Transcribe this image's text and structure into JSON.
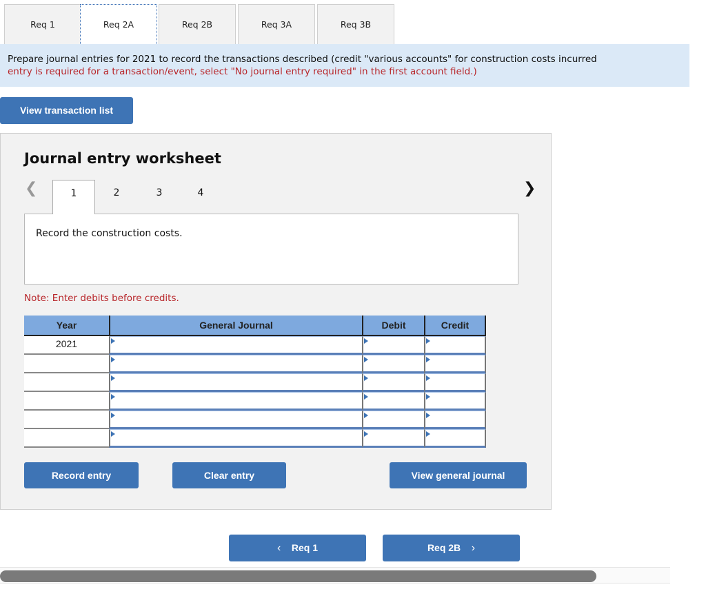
{
  "req_tabs": [
    {
      "label": "Req 1",
      "active": false
    },
    {
      "label": "Req 2A",
      "active": true
    },
    {
      "label": "Req 2B",
      "active": false
    },
    {
      "label": "Req 3A",
      "active": false
    },
    {
      "label": "Req 3B",
      "active": false
    }
  ],
  "instructions": {
    "line1": "Prepare journal entries for 2021 to record the transactions described (credit \"various accounts\" for construction costs incurred",
    "line2": "entry is required for a transaction/event, select \"No journal entry required\" in the first account field.)"
  },
  "view_transaction_list_label": "View transaction list",
  "worksheet": {
    "title": "Journal entry worksheet",
    "prev_icon": "chevron-left-icon",
    "next_icon": "chevron-right-icon",
    "entry_tabs": [
      {
        "label": "1",
        "active": true
      },
      {
        "label": "2",
        "active": false
      },
      {
        "label": "3",
        "active": false
      },
      {
        "label": "4",
        "active": false
      }
    ],
    "description": "Record the construction costs.",
    "note": "Note: Enter debits before credits.",
    "table": {
      "headers": {
        "year": "Year",
        "general_journal": "General Journal",
        "debit": "Debit",
        "credit": "Credit"
      },
      "rows": [
        {
          "year": "2021",
          "account": "",
          "debit": "",
          "credit": ""
        },
        {
          "year": "",
          "account": "",
          "debit": "",
          "credit": ""
        },
        {
          "year": "",
          "account": "",
          "debit": "",
          "credit": ""
        },
        {
          "year": "",
          "account": "",
          "debit": "",
          "credit": ""
        },
        {
          "year": "",
          "account": "",
          "debit": "",
          "credit": ""
        },
        {
          "year": "",
          "account": "",
          "debit": "",
          "credit": ""
        }
      ]
    },
    "buttons": {
      "record": "Record entry",
      "clear": "Clear entry",
      "view_general_journal": "View general journal"
    }
  },
  "bottom_nav": {
    "prev_label": "Req 1",
    "next_label": "Req 2B"
  },
  "scrollbar": {
    "thumb_fraction": 0.89
  },
  "colors": {
    "button_blue": "#3e74b5",
    "header_blue": "#7ea9de",
    "banner_blue": "#dbe9f7",
    "error_red": "#b8262a"
  }
}
